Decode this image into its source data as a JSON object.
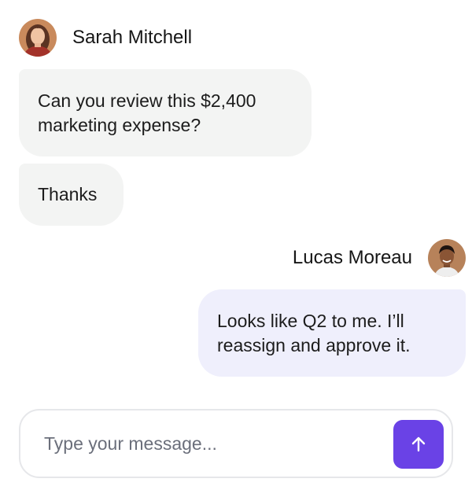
{
  "messages": [
    {
      "sender": "Sarah Mitchell",
      "side": "left",
      "bubbles": [
        {
          "text": "Can you review this $2,400 marketing expense?"
        },
        {
          "text": "Thanks"
        }
      ]
    },
    {
      "sender": "Lucas Moreau",
      "side": "right",
      "bubbles": [
        {
          "text": "Looks like Q2 to me. I’ll reassign and approve it."
        }
      ]
    }
  ],
  "composer": {
    "placeholder": "Type your message...",
    "value": "",
    "send_icon": "arrow-up-icon"
  },
  "colors": {
    "accent": "#6a42e6",
    "incoming_bubble": "#f3f4f3",
    "outgoing_bubble": "#efeffc",
    "composer_border": "#e6e7ea",
    "placeholder": "#6b6f7b"
  }
}
